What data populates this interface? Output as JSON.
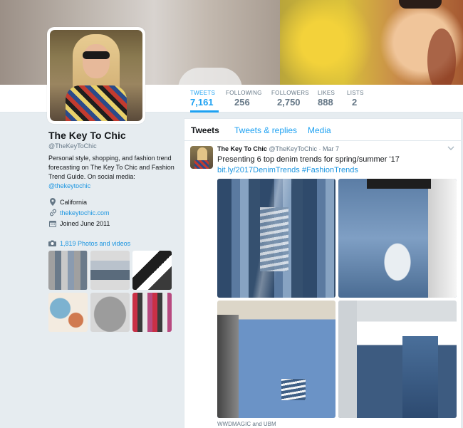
{
  "profile": {
    "name": "The Key To Chic",
    "handle": "@TheKeyToChic",
    "bio_prefix": "Personal style, shopping, and fashion trend forecasting on The Key To Chic and Fashion Trend Guide. On social media:",
    "bio_link": "@thekeytochic",
    "location": "California",
    "website": "thekeytochic.com",
    "joined": "Joined June 2011",
    "photos_link": "1,819 Photos and videos"
  },
  "stats": [
    {
      "label": "TWEETS",
      "value": "7,161"
    },
    {
      "label": "FOLLOWING",
      "value": "256"
    },
    {
      "label": "FOLLOWERS",
      "value": "2,750"
    },
    {
      "label": "LIKES",
      "value": "888"
    },
    {
      "label": "LISTS",
      "value": "2"
    }
  ],
  "tabs": [
    "Tweets",
    "Tweets & replies",
    "Media"
  ],
  "tweet": {
    "name": "The Key To Chic",
    "handle": "@TheKeyToChic",
    "date": "· Mar 7",
    "text": "Presenting 6 top denim trends for spring/summer '17",
    "link": "bit.ly/2017DenimTrends",
    "hashtag": "#FashionTrends",
    "source": "WWDMAGIC and UBM"
  },
  "icons": {
    "location": "location-pin-icon",
    "link": "link-icon",
    "calendar": "calendar-icon",
    "camera": "camera-icon",
    "chevron": "chevron-down-icon"
  },
  "colors": {
    "accent": "#1da1f2",
    "link": "#1b95e0",
    "background": "#e6ecf0"
  }
}
